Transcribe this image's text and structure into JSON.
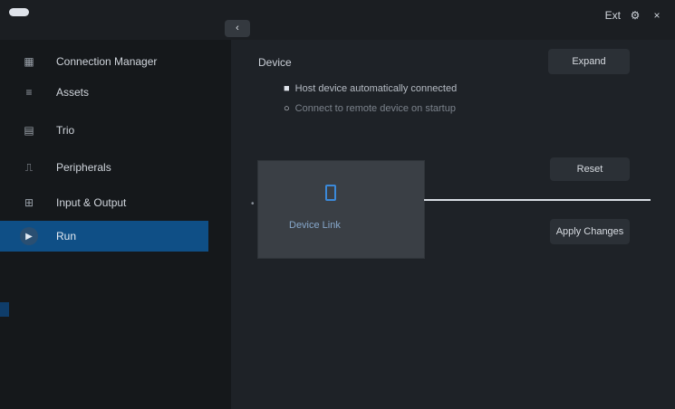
{
  "titlebar": {
    "back_label": "‹",
    "right_text": "Ext",
    "gear_glyph": "⚙",
    "close_glyph": "×"
  },
  "sidebar": {
    "items": [
      {
        "label": "Connection Manager",
        "icon": "network-icon",
        "glyph": "▦"
      },
      {
        "label": "Assets",
        "icon": "stack-icon",
        "glyph": "≡"
      },
      {
        "label": "Trio",
        "icon": "layout-icon",
        "glyph": "▤"
      },
      {
        "label": "Peripherals",
        "icon": "usb-icon",
        "glyph": "⎍"
      },
      {
        "label": "Input & Output",
        "icon": "grid-icon",
        "glyph": "⊞"
      },
      {
        "label": "Run",
        "icon": "play-icon",
        "glyph": "▶",
        "active": true
      }
    ]
  },
  "main": {
    "section_title": "Device",
    "expand_label": "Expand",
    "options": [
      {
        "mark": "■",
        "text": "Host device automatically connected"
      },
      {
        "mark": "○",
        "text": "Connect to remote device on startup"
      }
    ],
    "device_card_label": "Device Link",
    "side_marker": "•",
    "reset_label": "Reset",
    "apply_label": "Apply Changes"
  },
  "colors": {
    "background": "#1e2227",
    "sidebar": "#15181b",
    "accent": "#0f4f86",
    "card": "#3a3f45",
    "link": "#3b89d9"
  }
}
